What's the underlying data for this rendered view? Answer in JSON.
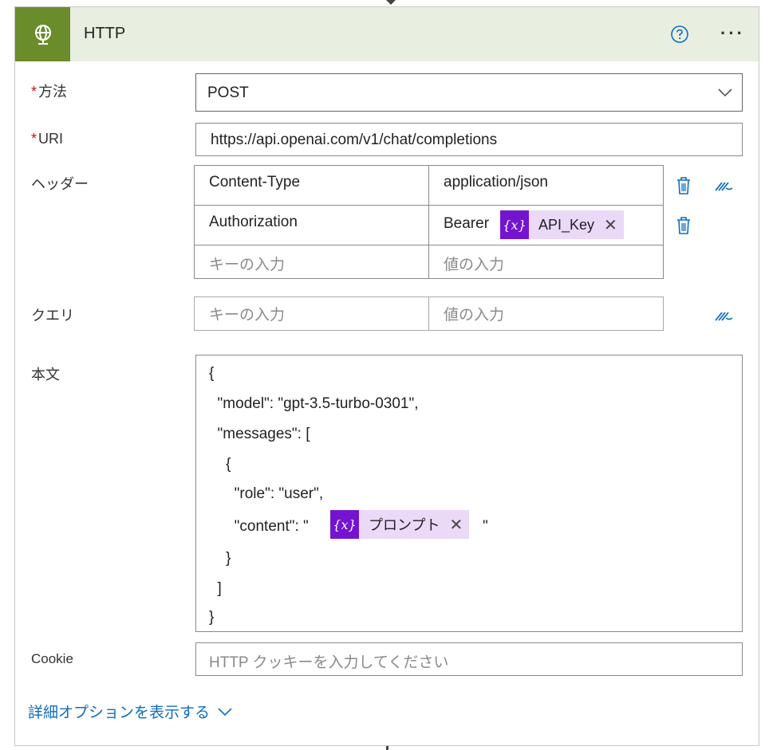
{
  "header": {
    "title": "HTTP"
  },
  "method": {
    "label": "方法",
    "value": "POST"
  },
  "uri": {
    "label": "URI",
    "value": "https://api.openai.com/v1/chat/completions"
  },
  "headers": {
    "label": "ヘッダー",
    "rows": [
      {
        "key": "Content-Type",
        "value": "application/json"
      },
      {
        "key": "Authorization",
        "value_prefix": "Bearer",
        "token": "API_Key"
      }
    ],
    "key_placeholder": "キーの入力",
    "value_placeholder": "値の入力"
  },
  "query": {
    "label": "クエリ",
    "key_placeholder": "キーの入力",
    "value_placeholder": "値の入力"
  },
  "body": {
    "label": "本文",
    "lines": [
      "{",
      "  \"model\": \"gpt-3.5-turbo-0301\",",
      "  \"messages\": [",
      "    {",
      "      \"role\": \"user\",",
      "      \"content\": \"",
      "    }",
      "  ]",
      "}"
    ],
    "content_token": "プロンプト",
    "content_suffix": "\""
  },
  "cookie": {
    "label": "Cookie",
    "placeholder": "HTTP クッキーを入力してください"
  },
  "advanced_options": {
    "label": "詳細オプションを表示する"
  },
  "colors": {
    "header_bg": "#e8efe0",
    "icon_bg": "#6a8c2b",
    "token_icon": "#7414d0",
    "token_bg": "#ead9f7",
    "link": "#0f6cbd"
  }
}
